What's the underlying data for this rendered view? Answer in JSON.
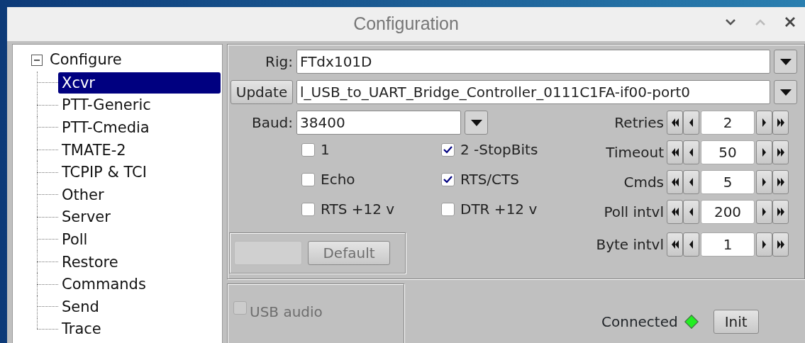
{
  "window": {
    "title": "Configuration"
  },
  "tree": {
    "label": "Configure",
    "expanded": true,
    "children": [
      {
        "label": "Xcvr",
        "selected": true
      },
      {
        "label": "PTT-Generic",
        "selected": false
      },
      {
        "label": "PTT-Cmedia",
        "selected": false
      },
      {
        "label": "TMATE-2",
        "selected": false
      },
      {
        "label": "TCPIP & TCI",
        "selected": false
      },
      {
        "label": "Other",
        "selected": false
      },
      {
        "label": "Server",
        "selected": false
      },
      {
        "label": "Poll",
        "selected": false
      },
      {
        "label": "Restore",
        "selected": false
      },
      {
        "label": "Commands",
        "selected": false
      },
      {
        "label": "Send",
        "selected": false
      },
      {
        "label": "Trace",
        "selected": false
      }
    ]
  },
  "rig": {
    "label": "Rig:",
    "value": "FTdx101D"
  },
  "port": {
    "button": "Update",
    "value": "l_USB_to_UART_Bridge_Controller_0111C1FA-if00-port0"
  },
  "baud": {
    "label": "Baud:",
    "value": "38400"
  },
  "checkboxes": [
    {
      "label": "1",
      "checked": false
    },
    {
      "label": "2 -StopBits",
      "checked": true
    },
    {
      "label": "Echo",
      "checked": false
    },
    {
      "label": "RTS/CTS",
      "checked": true
    },
    {
      "label": "RTS +12 v",
      "checked": false
    },
    {
      "label": "DTR +12 v",
      "checked": false
    }
  ],
  "spinners": [
    {
      "label": "Retries",
      "value": "2"
    },
    {
      "label": "Timeout",
      "value": "50"
    },
    {
      "label": "Cmds",
      "value": "5"
    },
    {
      "label": "Poll intvl",
      "value": "200"
    },
    {
      "label": "Byte intvl",
      "value": "1"
    }
  ],
  "default_button": {
    "label": "Default",
    "disabled": true
  },
  "usb_audio": {
    "label": "USB audio",
    "checked": false,
    "disabled": true
  },
  "status": {
    "label": "Connected",
    "connected": true
  },
  "init_button": {
    "label": "Init"
  }
}
